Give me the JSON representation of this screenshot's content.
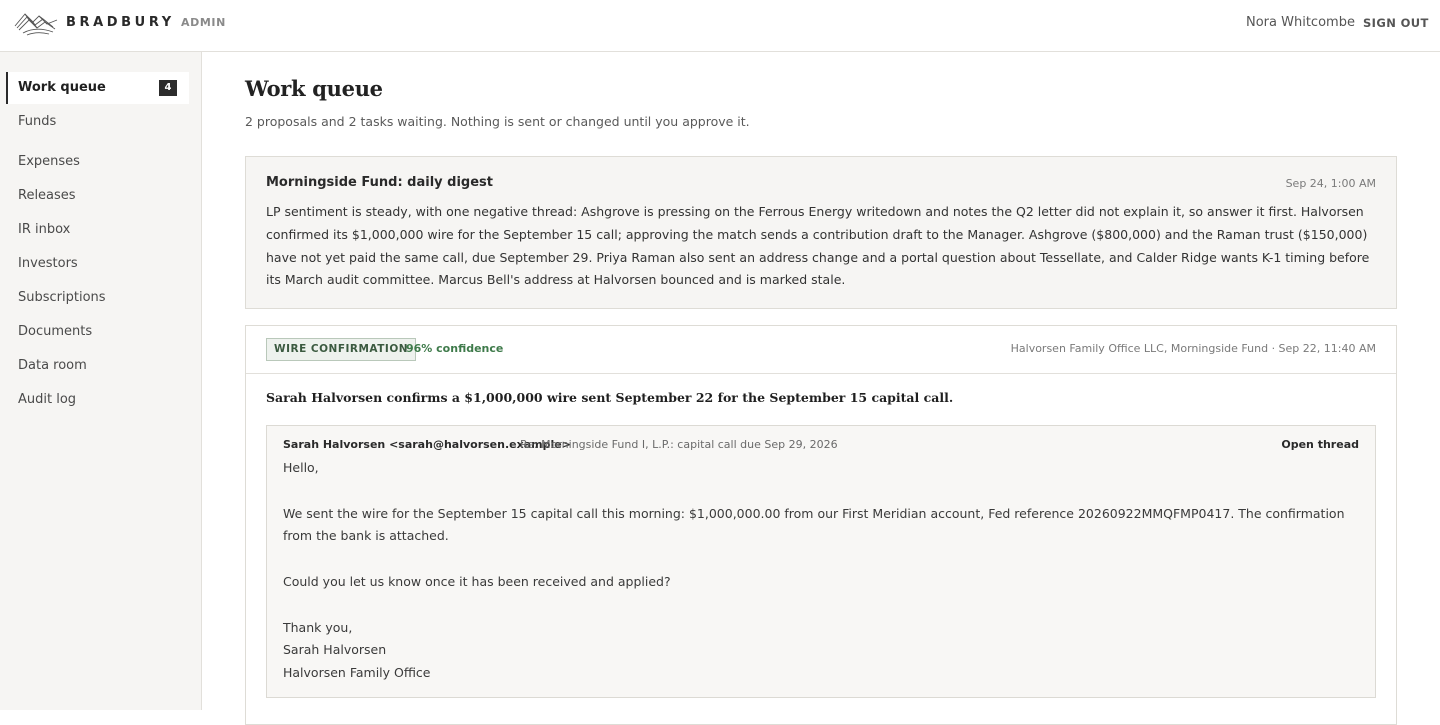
{
  "header": {
    "brand": "BRADBURY",
    "section": "ADMIN",
    "user_name": "Nora Whitcombe",
    "sign_out": "SIGN OUT"
  },
  "sidebar": {
    "items": [
      {
        "label": "Work queue",
        "badge": "4",
        "active": true
      },
      {
        "label": "Funds"
      },
      {
        "label": "Expenses"
      },
      {
        "label": "Releases"
      },
      {
        "label": "IR inbox"
      },
      {
        "label": "Investors"
      },
      {
        "label": "Subscriptions"
      },
      {
        "label": "Documents"
      },
      {
        "label": "Data room"
      },
      {
        "label": "Audit log"
      }
    ]
  },
  "main": {
    "title": "Work queue",
    "subtitle": "2 proposals and 2 tasks waiting. Nothing is sent or changed until you approve it."
  },
  "digest": {
    "title": "Morningside Fund: daily digest",
    "time": "Sep 24, 1:00 AM",
    "body": "LP sentiment is steady, with one negative thread: Ashgrove is pressing on the Ferrous Energy writedown and notes the Q2 letter did not explain it, so answer it first. Halvorsen confirmed its $1,000,000 wire for the September 15 call; approving the match sends a contribution draft to the Manager. Ashgrove ($800,000) and the Raman trust ($150,000) have not yet paid the same call, due September 29. Priya Raman also sent an address change and a portal question about Tessellate, and Calder Ridge wants K-1 timing before its March audit committee. Marcus Bell's address at Halvorsen bounced and is marked stale."
  },
  "card": {
    "tag": "WIRE CONFIRMATION",
    "confidence": "96% confidence",
    "meta": "Halvorsen Family Office LLC, Morningside Fund · Sep 22, 11:40 AM",
    "summary": "Sarah Halvorsen confirms a $1,000,000 wire sent September 22 for the September 15 capital call.",
    "email": {
      "from": "Sarah Halvorsen <sarah@halvorsen.example>",
      "subject": "· Re: Morningside Fund I, L.P.: capital call due Sep 29, 2026",
      "open_thread": "Open thread",
      "greeting": "Hello,",
      "para1": "We sent the wire for the September 15 capital call this morning: $1,000,000.00 from our First Meridian account, Fed reference 20260922MMQFMP0417. The confirmation from the bank is attached.",
      "para2": "Could you let us know once it has been received and applied?",
      "signoff": "Thank you,",
      "sig_name": "Sarah Halvorsen",
      "sig_org": "Halvorsen Family Office"
    }
  },
  "colors": {
    "accent_dark": "#2c2c2c",
    "confidence_green": "#3e7a4a",
    "tag_bg": "#eef2ee",
    "sidebar_bg": "#f6f5f3"
  }
}
